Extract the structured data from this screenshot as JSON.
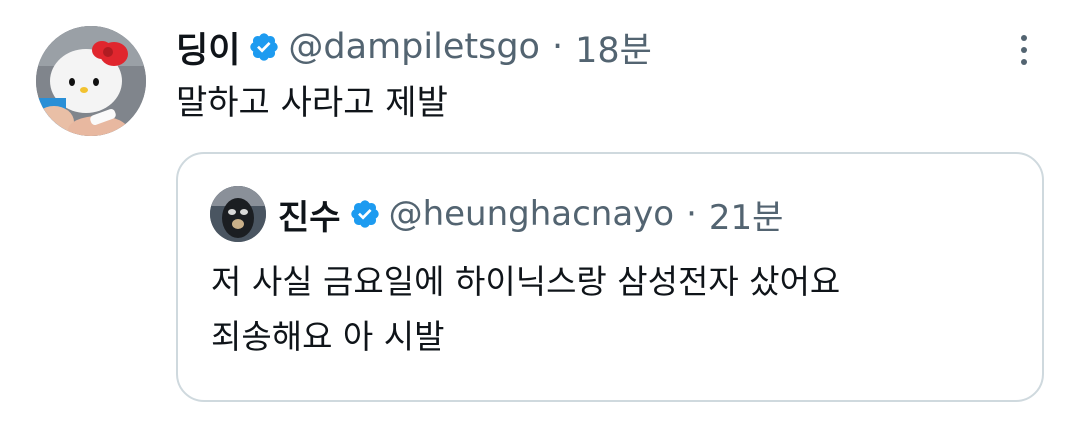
{
  "tweet": {
    "display_name": "딩이",
    "handle": "@dampiletsgo",
    "separator": "·",
    "time": "18분",
    "text": "말하고 사라고 제발",
    "avatar_icon": "hello-kitty-plush-avatar",
    "verified_icon": "verified-badge-icon",
    "more_icon": "more-options-icon",
    "accent_color": "#1d9bf0"
  },
  "quoted": {
    "display_name": "진수",
    "handle": "@heunghacnayo",
    "separator": "·",
    "time": "21분",
    "lines": [
      "저 사실 금요일에 하이닉스랑 삼성전자 샀어요",
      "죄송해요 아 시발"
    ],
    "avatar_icon": "dark-character-avatar",
    "verified_icon": "verified-badge-icon"
  }
}
